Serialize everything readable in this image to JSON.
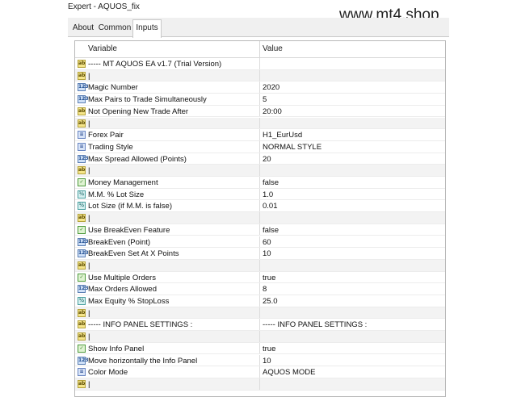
{
  "window": {
    "title": "Expert - AQUOS_fix"
  },
  "watermark": "www.mt4.shop",
  "tabs": [
    {
      "label": "About",
      "active": false
    },
    {
      "label": "Common",
      "active": false
    },
    {
      "label": "Inputs",
      "active": true
    }
  ],
  "table": {
    "headers": {
      "variable": "Variable",
      "value": "Value"
    },
    "rows": [
      {
        "icon": "ab",
        "variable": "----- MT AQUOS EA v1.7 (Trial Version)",
        "value": ""
      },
      {
        "icon": "ab",
        "variable": "|",
        "value": ""
      },
      {
        "icon": "num",
        "variable": "Magic Number",
        "value": "2020"
      },
      {
        "icon": "num",
        "variable": "Max Pairs to Trade Simultaneously",
        "value": "5"
      },
      {
        "icon": "ab",
        "variable": "Not Opening New Trade After",
        "value": "20:00"
      },
      {
        "icon": "ab",
        "variable": "|",
        "value": ""
      },
      {
        "icon": "enm",
        "variable": "Forex Pair",
        "value": "H1_EurUsd"
      },
      {
        "icon": "enm",
        "variable": "Trading Style",
        "value": "NORMAL STYLE"
      },
      {
        "icon": "num",
        "variable": "Max Spread Allowed (Points)",
        "value": "20"
      },
      {
        "icon": "ab",
        "variable": "|",
        "value": ""
      },
      {
        "icon": "bool",
        "variable": "Money Management",
        "value": "false"
      },
      {
        "icon": "dbl",
        "variable": "M.M. % Lot Size",
        "value": "1.0"
      },
      {
        "icon": "dbl",
        "variable": "Lot Size (if M.M. is false)",
        "value": "0.01"
      },
      {
        "icon": "ab",
        "variable": "|",
        "value": ""
      },
      {
        "icon": "bool",
        "variable": "Use BreakEven Feature",
        "value": "false"
      },
      {
        "icon": "num",
        "variable": "BreakEven (Point)",
        "value": "60"
      },
      {
        "icon": "num",
        "variable": "BreakEven Set At X Points",
        "value": "10"
      },
      {
        "icon": "ab",
        "variable": "|",
        "value": ""
      },
      {
        "icon": "bool",
        "variable": "Use Multiple Orders",
        "value": "true"
      },
      {
        "icon": "num",
        "variable": "Max Orders Allowed",
        "value": "8"
      },
      {
        "icon": "dbl",
        "variable": "Max Equity % StopLoss",
        "value": "25.0"
      },
      {
        "icon": "ab",
        "variable": "|",
        "value": ""
      },
      {
        "icon": "ab",
        "variable": "----- INFO PANEL SETTINGS :",
        "value": "----- INFO PANEL SETTINGS :"
      },
      {
        "icon": "ab",
        "variable": "|",
        "value": ""
      },
      {
        "icon": "bool",
        "variable": "Show Info Panel",
        "value": "true"
      },
      {
        "icon": "num",
        "variable": "Move horizontally the Info Panel",
        "value": "10"
      },
      {
        "icon": "enm",
        "variable": "Color Mode",
        "value": "AQUOS MODE"
      },
      {
        "icon": "ab",
        "variable": "|",
        "value": ""
      }
    ]
  },
  "icon_glyphs": {
    "ab": "ab",
    "num": "123",
    "dbl": "½",
    "bool": "✓",
    "enm": "≡"
  }
}
